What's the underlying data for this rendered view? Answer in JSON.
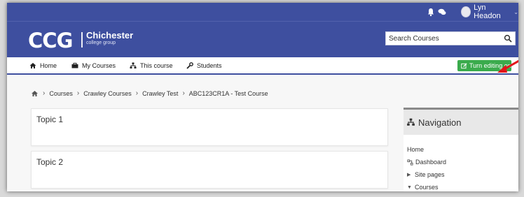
{
  "topbar": {
    "notifications_icon": "bell-icon",
    "messages_icon": "chat-bubbles-icon",
    "user_name": "Lyn Headon",
    "caret": "⌄"
  },
  "header": {
    "logo_text": "CCG",
    "logo_name": "Chichester",
    "logo_sub": "college group",
    "search_placeholder": "Search Courses",
    "search_icon": "search-icon"
  },
  "navbar": {
    "items": [
      {
        "label": "Home",
        "icon": "home-icon"
      },
      {
        "label": "My Courses",
        "icon": "courses-icon"
      },
      {
        "label": "This course",
        "icon": "sitemap-icon"
      },
      {
        "label": "Students",
        "icon": "wrench-icon"
      }
    ],
    "turn_editing_label": "Turn editing on"
  },
  "breadcrumb": [
    "Courses",
    "Crawley Courses",
    "Crawley Test",
    "ABC123CR1A - Test Course"
  ],
  "topics": [
    {
      "title": "Topic 1"
    },
    {
      "title": "Topic 2"
    }
  ],
  "navigation_block": {
    "title": "Navigation",
    "items": [
      {
        "label": "Home"
      },
      {
        "label": "Dashboard"
      },
      {
        "label": "Site pages"
      },
      {
        "label": "Courses"
      }
    ]
  },
  "colors": {
    "brand_blue": "#3e4f9f",
    "edit_green": "#3aab4c",
    "annotation_arrow": "#e3151a"
  }
}
